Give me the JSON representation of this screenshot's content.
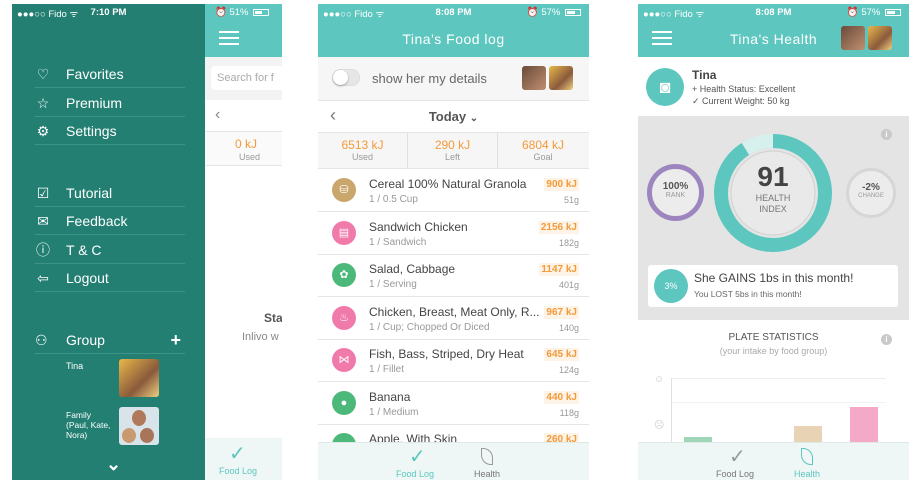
{
  "p1": {
    "status": {
      "carrier": "●●●○○ Fido ᯤ",
      "time": "7:10 PM",
      "battery": "51%"
    },
    "menu": [
      {
        "icon": "heart-icon",
        "glyph": "♡",
        "label": "Favorites"
      },
      {
        "icon": "star-icon",
        "glyph": "☆",
        "label": "Premium"
      },
      {
        "icon": "gear-icon",
        "glyph": "⚙",
        "label": "Settings"
      },
      {
        "icon": "tutorial-icon",
        "glyph": "☑",
        "label": "Tutorial"
      },
      {
        "icon": "feedback-icon",
        "glyph": "✉",
        "label": "Feedback"
      },
      {
        "icon": "info-icon",
        "glyph": "ⓘ",
        "label": "T & C"
      },
      {
        "icon": "logout-icon",
        "glyph": "⇦",
        "label": "Logout"
      }
    ],
    "group": {
      "label": "Group",
      "add": "+",
      "members": [
        {
          "name": "Tina"
        },
        {
          "name": "Family\n(Paul, Kate,\nNora)"
        }
      ]
    },
    "chevron": "⌄",
    "bg": {
      "search": "Search for f",
      "kj": "0 kJ",
      "used": "Used",
      "sta": "Sta",
      "inlivo": "Inlivo w",
      "food_log": "Food Log"
    }
  },
  "p2": {
    "status": {
      "carrier": "●●●○○ Fido ᯤ",
      "time": "8:08 PM",
      "battery": "57%"
    },
    "title": "Tina's  Food log",
    "toggle_label": "show her my details",
    "date": "Today",
    "summary": [
      {
        "v": "6513 kJ",
        "l": "Used"
      },
      {
        "v": "290 kJ",
        "l": "Left"
      },
      {
        "v": "6804 kJ",
        "l": "Goal"
      }
    ],
    "foods": [
      {
        "name": "Cereal  100% Natural Granola",
        "serving": "1 / 0.5 Cup",
        "kj": "900 kJ",
        "g": "51g",
        "color": "#c9a66b",
        "glyph": "⛁"
      },
      {
        "name": "Sandwich Chicken",
        "serving": "1 / Sandwich",
        "kj": "2156 kJ",
        "g": "182g",
        "color": "#f07aa9",
        "glyph": "▤"
      },
      {
        "name": "Salad, Cabbage",
        "serving": "1 / Serving",
        "kj": "1147 kJ",
        "g": "401g",
        "color": "#4cb87a",
        "glyph": "✿"
      },
      {
        "name": "Chicken, Breast, Meat Only, R...",
        "serving": "1 / Cup; Chopped Or Diced",
        "kj": "967 kJ",
        "g": "140g",
        "color": "#f07aa9",
        "glyph": "♨"
      },
      {
        "name": "Fish, Bass, Striped, Dry Heat",
        "serving": "1 / Fillet",
        "kj": "645 kJ",
        "g": "124g",
        "color": "#f07aa9",
        "glyph": "⋈"
      },
      {
        "name": "Banana",
        "serving": "1 / Medium",
        "kj": "440 kJ",
        "g": "118g",
        "color": "#4cb87a",
        "glyph": "●"
      },
      {
        "name": "Apple, With Skin",
        "serving": "",
        "kj": "260 kJ",
        "g": "",
        "color": "#4cb87a",
        "glyph": "●"
      }
    ],
    "tabs": {
      "food_log": "Food Log",
      "health": "Health"
    }
  },
  "p3": {
    "status": {
      "carrier": "●●●○○ Fido ᯤ",
      "time": "8:08 PM",
      "battery": "57%"
    },
    "title": "Tina's  Health",
    "name": "Tina",
    "health_status": "+ Health Status: Excellent",
    "weight": "✓ Current Weight: 50 kg",
    "rank": {
      "value": "100%",
      "label": "RANK"
    },
    "index": {
      "value": "91",
      "label": "HEALTH\nINDEX",
      "fraction": 0.91
    },
    "change": {
      "value": "-2%",
      "label": "CHANGE"
    },
    "gain": {
      "badge": "3%",
      "text": "She GAINS 1bs in this month!",
      "sub": "You LOST 5bs in this month!"
    },
    "plate": {
      "title": "PLATE STATISTICS",
      "sub": "(your intake by food group)"
    },
    "bars": [
      {
        "color": "#9fd6b8",
        "value": 0.08
      },
      {
        "color": "#e8d3b5",
        "value": 0.25
      },
      {
        "color": "#f5a9c8",
        "value": 0.55
      }
    ],
    "tabs": {
      "food_log": "Food Log",
      "health": "Health"
    }
  }
}
